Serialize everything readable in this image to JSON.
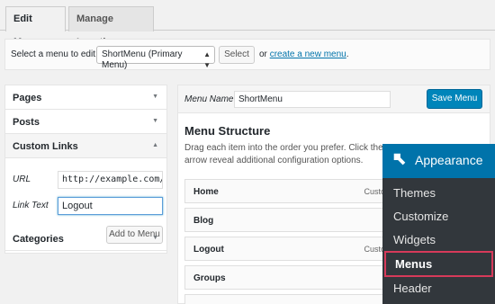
{
  "tabs": [
    {
      "label": "Edit Menus",
      "active": true
    },
    {
      "label": "Manage Locations",
      "active": false
    }
  ],
  "select_bar": {
    "label": "Select a menu to edit:",
    "selected_menu": "ShortMenu (Primary Menu)",
    "select_button": "Select",
    "or_text": "or",
    "create_link": "create a new menu",
    "period": "."
  },
  "accordion": {
    "sections": [
      {
        "label": "Pages",
        "expanded": false
      },
      {
        "label": "Posts",
        "expanded": false
      },
      {
        "label": "Custom Links",
        "expanded": true
      },
      {
        "label": "Categories",
        "expanded": false
      }
    ],
    "url_label": "URL",
    "url_value": "http://example.com/w",
    "link_text_label": "Link Text",
    "link_text_value": "Logout",
    "add_button": "Add to Menu"
  },
  "menu_edit": {
    "name_label": "Menu Name",
    "name_value": "ShortMenu",
    "save_button": "Save Menu",
    "structure_title": "Menu Structure",
    "description": "Drag each item into the order you prefer. Click the arrow reveal additional configuration options.",
    "items": [
      {
        "label": "Home",
        "type": "Custo"
      },
      {
        "label": "Blog",
        "type": ""
      },
      {
        "label": "Logout",
        "type": "Custo"
      },
      {
        "label": "Groups",
        "type": ""
      },
      {
        "label": "",
        "type": ""
      }
    ]
  },
  "flyout": {
    "header": "Appearance",
    "items": [
      {
        "label": "Themes",
        "active": false
      },
      {
        "label": "Customize",
        "active": false
      },
      {
        "label": "Widgets",
        "active": false
      },
      {
        "label": "Menus",
        "active": true
      },
      {
        "label": "Header",
        "active": false
      }
    ]
  },
  "colors": {
    "primary_button": "#0085ba",
    "flyout_header": "#0073aa",
    "flyout_bg": "#32373c",
    "highlight": "#d63a5a",
    "link": "#0073aa"
  }
}
